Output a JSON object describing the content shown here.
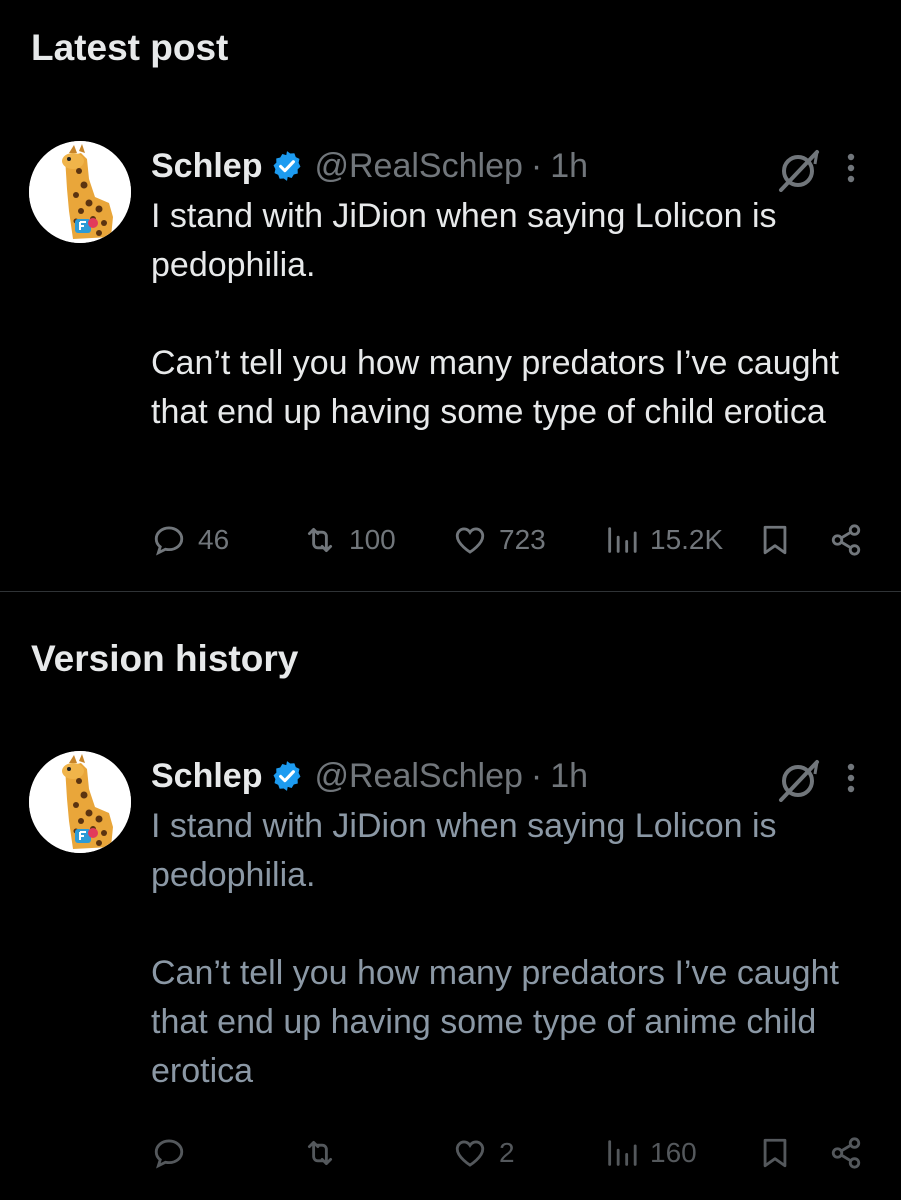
{
  "sections": {
    "latest_title": "Latest post",
    "version_title": "Version history"
  },
  "latest_post": {
    "display_name": "Schlep",
    "handle": "@RealSchlep",
    "separator": "·",
    "time": "1h",
    "paragraph_1": "I stand with JiDion when saying Lolicon is pedophilia.",
    "paragraph_2": "Can’t tell you how many predators I’ve caught that end up having some type of child erotica",
    "replies": "46",
    "reposts": "100",
    "likes": "723",
    "views": "15.2K"
  },
  "version_post": {
    "display_name": "Schlep",
    "handle": "@RealSchlep",
    "separator": "·",
    "time": "1h",
    "paragraph_1": "I stand with JiDion when saying Lolicon is pedophilia.",
    "paragraph_2": "Can’t tell you how many predators I’ve caught that end up having some type of anime child erotica",
    "replies": "",
    "reposts": "",
    "likes": "2",
    "views": "160"
  },
  "icons": {
    "avatar": "giraffe-avatar",
    "verified": "verified-badge-icon",
    "grok": "grok-icon",
    "more": "more-vertical-icon",
    "reply": "reply-icon",
    "repost": "repost-icon",
    "like": "heart-icon",
    "views": "views-chart-icon",
    "bookmark": "bookmark-icon",
    "share": "share-icon"
  },
  "colors": {
    "background": "#000000",
    "text_primary": "#e7e9ea",
    "text_secondary": "#71767b",
    "verified_blue": "#1d9bf0",
    "divider": "#2f3336"
  }
}
